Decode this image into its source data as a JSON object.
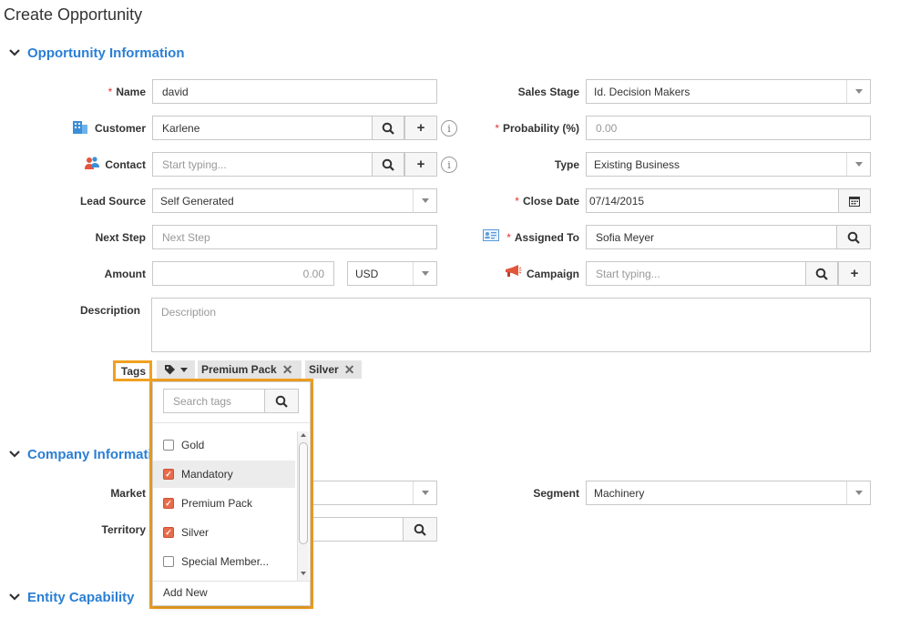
{
  "page_title": "Create Opportunity",
  "sections": {
    "opportunity": "Opportunity Information",
    "company": "Company Informati",
    "entity": "Entity Capability"
  },
  "form": {
    "name": {
      "label": "Name",
      "value": "david"
    },
    "customer": {
      "label": "Customer",
      "value": "Karlene"
    },
    "contact": {
      "label": "Contact",
      "placeholder": "Start typing..."
    },
    "lead_source": {
      "label": "Lead Source",
      "value": "Self Generated"
    },
    "next_step": {
      "label": "Next Step",
      "placeholder": "Next Step"
    },
    "amount": {
      "label": "Amount",
      "value": "0.00",
      "currency": "USD"
    },
    "description": {
      "label": "Description",
      "placeholder": "Description"
    },
    "tags_label": "Tags",
    "sales_stage": {
      "label": "Sales Stage",
      "value": "Id. Decision Makers"
    },
    "probability": {
      "label": "Probability (%)",
      "placeholder": "0.00"
    },
    "type": {
      "label": "Type",
      "value": "Existing Business"
    },
    "close_date": {
      "label": "Close Date",
      "value": "07/14/2015"
    },
    "assigned_to": {
      "label": "Assigned To",
      "value": "Sofia Meyer"
    },
    "campaign": {
      "label": "Campaign",
      "placeholder": "Start typing..."
    },
    "market": {
      "label": "Market"
    },
    "segment": {
      "label": "Segment",
      "value": "Machinery"
    },
    "territory": {
      "label": "Territory"
    }
  },
  "symbols": {
    "required": "*",
    "info": "i",
    "plus": "+",
    "remove": "✕"
  },
  "selected_tags": [
    "Premium Pack",
    "Silver"
  ],
  "tags_dropdown": {
    "search_placeholder": "Search tags",
    "items": [
      {
        "label": "Gold",
        "checked": false
      },
      {
        "label": "Mandatory",
        "checked": true
      },
      {
        "label": "Premium Pack",
        "checked": true
      },
      {
        "label": "Silver",
        "checked": true
      },
      {
        "label": "Special Member...",
        "checked": false
      }
    ],
    "add_new": "Add New"
  },
  "colors": {
    "accent": "#2b7fd4",
    "highlight": "#f0a020",
    "checkbox": "#e86c4a",
    "required": "#e0322f"
  }
}
